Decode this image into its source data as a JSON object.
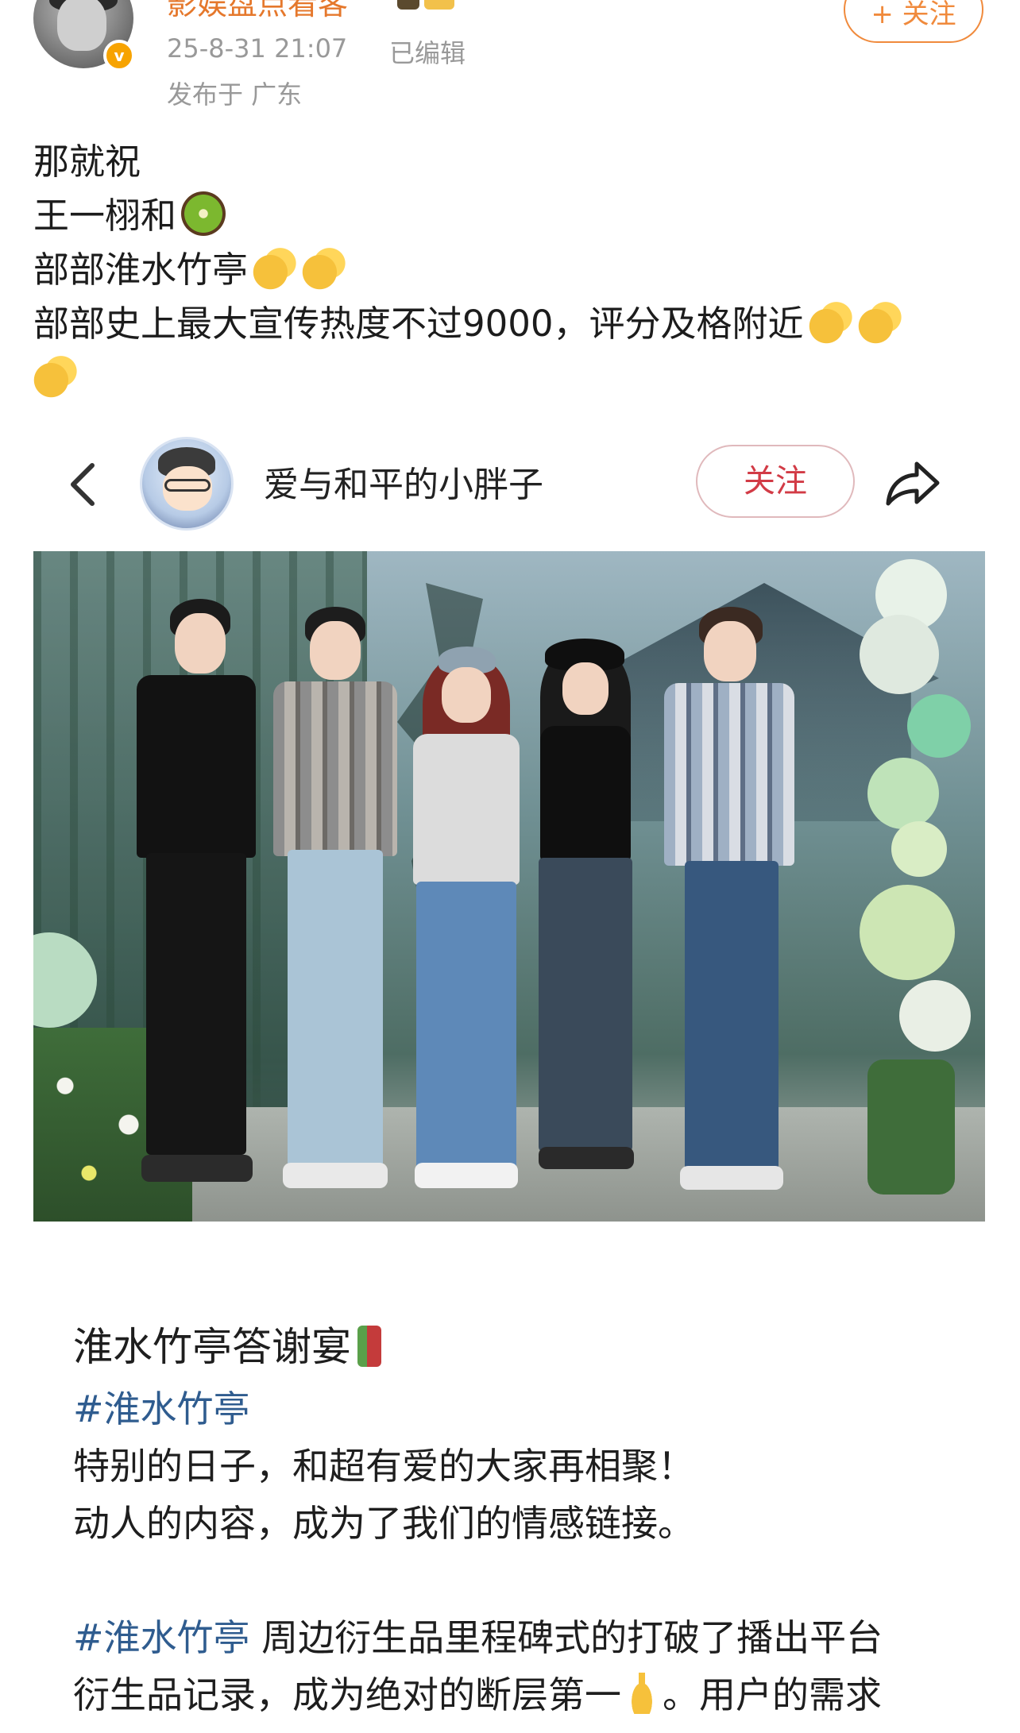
{
  "post_header": {
    "username": "影娱盘点看客",
    "time": "25-8-31 21:07",
    "edited": "已编辑",
    "location": "发布于 广东",
    "follow_label": "+ 关注",
    "verify_mark": "v"
  },
  "post_body": {
    "lines": [
      "那就祝",
      "王一栩和",
      "部部淮水竹亭",
      "部部史上最大宣传热度不过9000，评分及格附近"
    ]
  },
  "embed": {
    "username": "爱与和平的小胖子",
    "follow_label": "关注"
  },
  "caption": {
    "title": "淮水竹亭答谢宴",
    "line1_tag": "#淮水竹亭",
    "line2": "特别的日子，和超有爱的大家再相聚！",
    "line3": "动人的内容，成为了我们的情感链接。",
    "line5_tag": "#淮水竹亭",
    "line5_text": " 周边衍生品里程碑式的打破了播出平台",
    "line6_a": "衍生品记录，成为绝对的断层第一",
    "line6_b": "。用户的需求"
  },
  "icons": {
    "back": "chevron-left-icon",
    "share": "share-arrow-icon",
    "kiwi": "kiwi-emoji",
    "clap": "clapping-hands-emoji",
    "bamboo": "bamboo-emoji",
    "point": "pointing-up-emoji"
  },
  "colors": {
    "username_orange": "#e5782c",
    "follow_orange": "#f08a3c",
    "follow_red": "#d23b46",
    "hashtag_blue": "#2f5c8f",
    "meta_gray": "#999999"
  }
}
